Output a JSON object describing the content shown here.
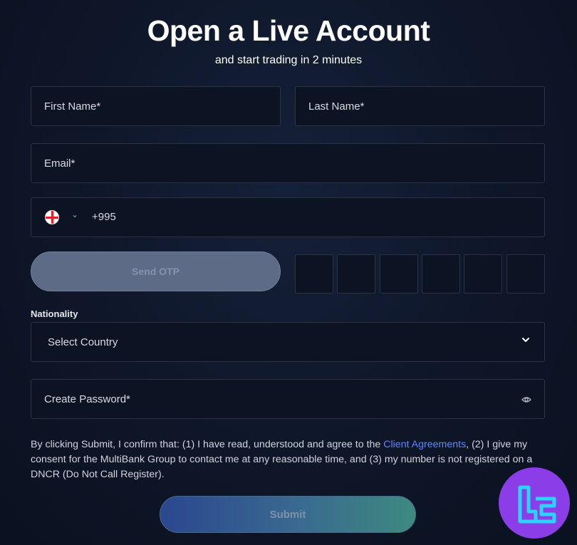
{
  "header": {
    "title": "Open a Live Account",
    "subtitle": "and start trading in 2 minutes"
  },
  "form": {
    "first_name": "First Name*",
    "last_name": "Last Name*",
    "email": "Email*",
    "phone": {
      "flag": "georgia-flag-icon",
      "dial_code": "+995"
    },
    "send_otp_label": "Send OTP",
    "otp_boxes": 6,
    "nationality_label": "Nationality",
    "country_select": "Select Country",
    "password": "Create Password*"
  },
  "consent": {
    "before_link": "By clicking Submit, I confirm that: (1) I have read, understood and agree to the ",
    "link_text": "Client Agreements",
    "after_link": ", (2) I give my consent for the MultiBank Group to contact me at any reasonable time, and (3) my number is not registered on a DNCR (Do Not Call Register)."
  },
  "submit_label": "Submit",
  "colors": {
    "background": "#0e1628",
    "field_border": "#2a3244",
    "link": "#5f87ff",
    "logo_bg": "#8b3de8",
    "logo_stroke": "#2ad4ff"
  }
}
